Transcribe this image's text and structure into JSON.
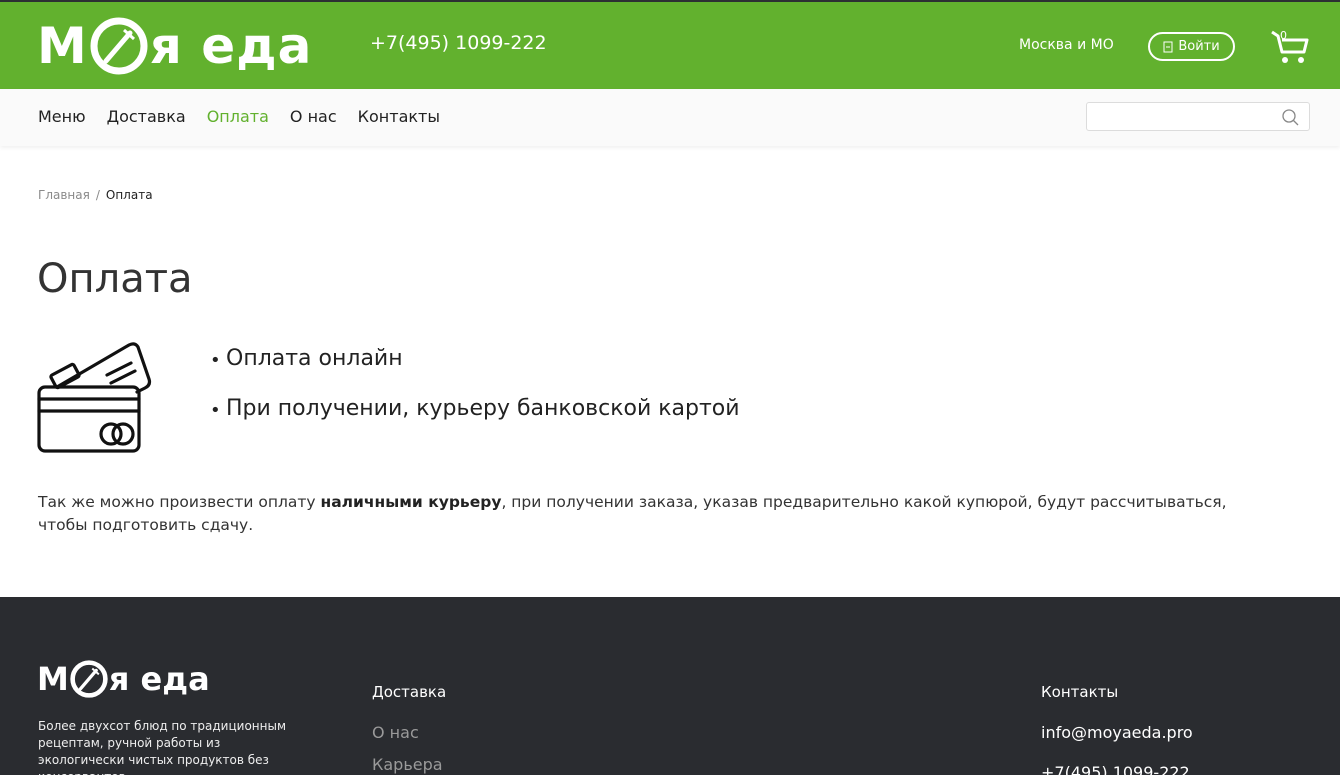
{
  "header": {
    "logo_left": "М",
    "logo_right": "я еда",
    "phone": "+7(495) 1099-222",
    "city": "Москва и МО",
    "login_label": "Войти",
    "cart_count": "0",
    "bg_color": "#62b12e"
  },
  "nav": {
    "items": [
      {
        "label": "Меню"
      },
      {
        "label": "Доставка"
      },
      {
        "label": "Оплата",
        "active": true
      },
      {
        "label": "О нас"
      },
      {
        "label": "Контакты"
      }
    ],
    "search_placeholder": ""
  },
  "breadcrumb": {
    "home": "Главная",
    "separator": "/",
    "current": "Оплата"
  },
  "page": {
    "title": "Оплата",
    "icon": "credit-card-icon",
    "methods": [
      "Оплата онлайн",
      "При получении, курьеру банковской картой"
    ],
    "note_before": "Так же можно произвести оплату ",
    "note_bold": "наличными курьеру",
    "note_after": ", при получении заказа, указав предварительно какой купюрой, будут рассчитываться, чтобы подготовить сдачу."
  },
  "footer": {
    "logo_left": "М",
    "logo_right": "я еда",
    "description": "Более двухсот блюд по традиционным рецептам, ручной работы из экологически чистых продуктов без консервантов,",
    "col1_title": "Доставка",
    "col1_links": [
      "О нас",
      "Карьера"
    ],
    "col2_title": "Контакты",
    "email": "info@moyaeda.pro",
    "phone": "+7(495) 1099-222",
    "bg_color": "#2a2c30"
  }
}
